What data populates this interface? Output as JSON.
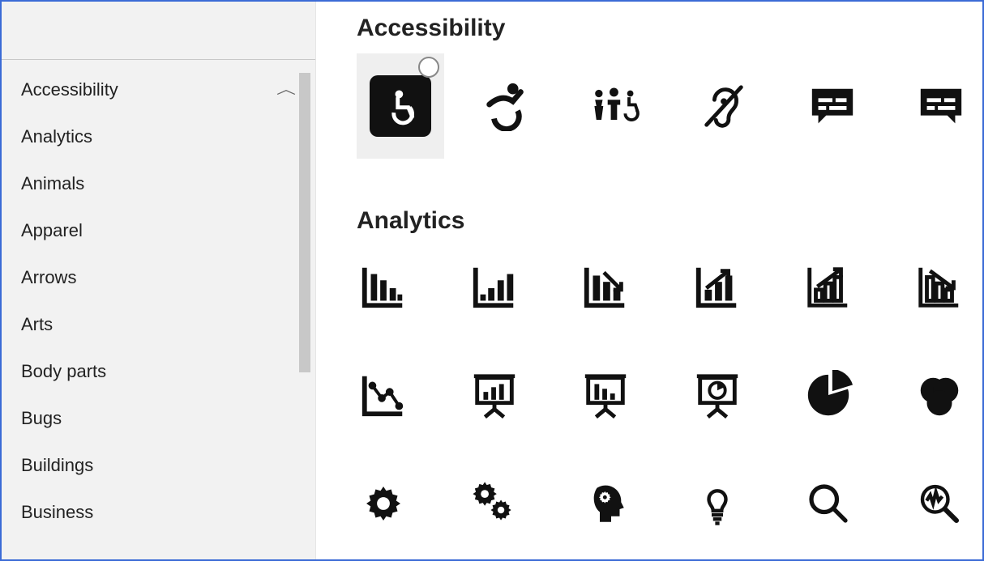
{
  "sidebar": {
    "items": [
      {
        "label": "Accessibility"
      },
      {
        "label": "Analytics"
      },
      {
        "label": "Animals"
      },
      {
        "label": "Apparel"
      },
      {
        "label": "Arrows"
      },
      {
        "label": "Arts"
      },
      {
        "label": "Body parts"
      },
      {
        "label": "Bugs"
      },
      {
        "label": "Buildings"
      },
      {
        "label": "Business"
      }
    ]
  },
  "sections": {
    "accessibility": {
      "title": "Accessibility"
    },
    "analytics": {
      "title": "Analytics"
    }
  },
  "icons": {
    "accessibility": [
      "wheelchair-symbol-icon",
      "accessible-motion-icon",
      "people-accessible-icon",
      "hearing-impaired-icon",
      "closed-caption-bubble-icon",
      "closed-caption-bubble-solid-icon"
    ],
    "analytics_row1": [
      "bar-chart-desc-icon",
      "bar-chart-asc-icon",
      "bar-chart-down-arrow-icon",
      "bar-chart-up-arrow-icon",
      "bar-chart-arrow-outline-icon",
      "bar-chart-arrow-outline2-icon"
    ],
    "analytics_row2": [
      "scatter-line-chart-icon",
      "presentation-bar-icon",
      "presentation-bar2-icon",
      "presentation-pie-icon",
      "pie-chart-icon",
      "venn-icon"
    ],
    "analytics_row3": [
      "gear-icon",
      "gears-icon",
      "head-gears-icon",
      "lightbulb-icon",
      "magnifier-icon",
      "magnifier-wave-icon"
    ]
  }
}
